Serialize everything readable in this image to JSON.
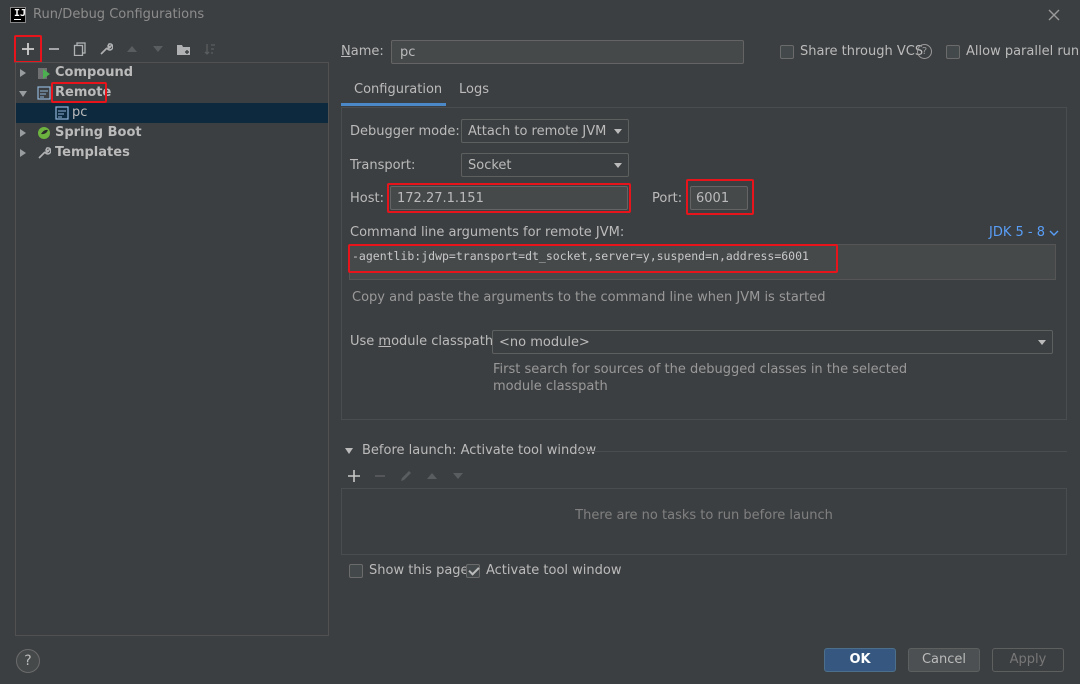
{
  "window": {
    "title": "Run/Debug Configurations",
    "app_icon": "intellij-icon",
    "close_icon": "close-icon"
  },
  "toolbar": {
    "icons": [
      "add-icon",
      "remove-icon",
      "copy-icon",
      "wrench-icon",
      "move-up-icon",
      "move-down-icon",
      "new-folder-icon",
      "sort-icon"
    ]
  },
  "tree": {
    "items": [
      {
        "label": "Compound",
        "icon": "compound-icon",
        "expanded": false
      },
      {
        "label": "Remote",
        "icon": "remote-icon",
        "expanded": true,
        "children": [
          {
            "label": "pc",
            "selected": true
          }
        ]
      },
      {
        "label": "Spring Boot",
        "icon": "spring-boot-icon",
        "expanded": false
      },
      {
        "label": "Templates",
        "icon": "wrench-icon",
        "expanded": false
      }
    ]
  },
  "header": {
    "name_label": "Name:",
    "name_value": "pc",
    "share_label": "Share through VCS",
    "share_checked": false,
    "help_icon": "help-icon",
    "parallel_label": "Allow parallel run",
    "parallel_checked": false
  },
  "tabs": [
    {
      "label": "Configuration",
      "active": true
    },
    {
      "label": "Logs",
      "active": false
    }
  ],
  "config": {
    "debugger_mode_label": "Debugger mode:",
    "debugger_mode_value": "Attach to remote JVM",
    "transport_label": "Transport:",
    "transport_value": "Socket",
    "host_label": "Host:",
    "host_value": "172.27.1.151",
    "port_label": "Port:",
    "port_value": "6001",
    "cmd_label": "Command line arguments for remote JVM:",
    "jdk_link": "JDK 5 - 8",
    "cmd_value": "-agentlib:jdwp=transport=dt_socket,server=y,suspend=n,address=6001",
    "cmd_hint": "Copy and paste the arguments to the command line when JVM is started",
    "module_label": "Use module classpath:",
    "module_value": "<no module>",
    "module_hint_1": "First search for sources of the debugged classes in the selected",
    "module_hint_2": "module classpath"
  },
  "before_launch": {
    "title": "Before launch: Activate tool window",
    "empty_text": "There are no tasks to run before launch"
  },
  "footer_options": {
    "show_page_label": "Show this page",
    "show_page_checked": false,
    "activate_label": "Activate tool window",
    "activate_checked": true
  },
  "buttons": {
    "ok": "OK",
    "cancel": "Cancel",
    "apply": "Apply"
  },
  "colors": {
    "accent": "#4a88c7",
    "selection": "#0d293e",
    "highlight": "#e8141b",
    "link": "#589df6"
  }
}
